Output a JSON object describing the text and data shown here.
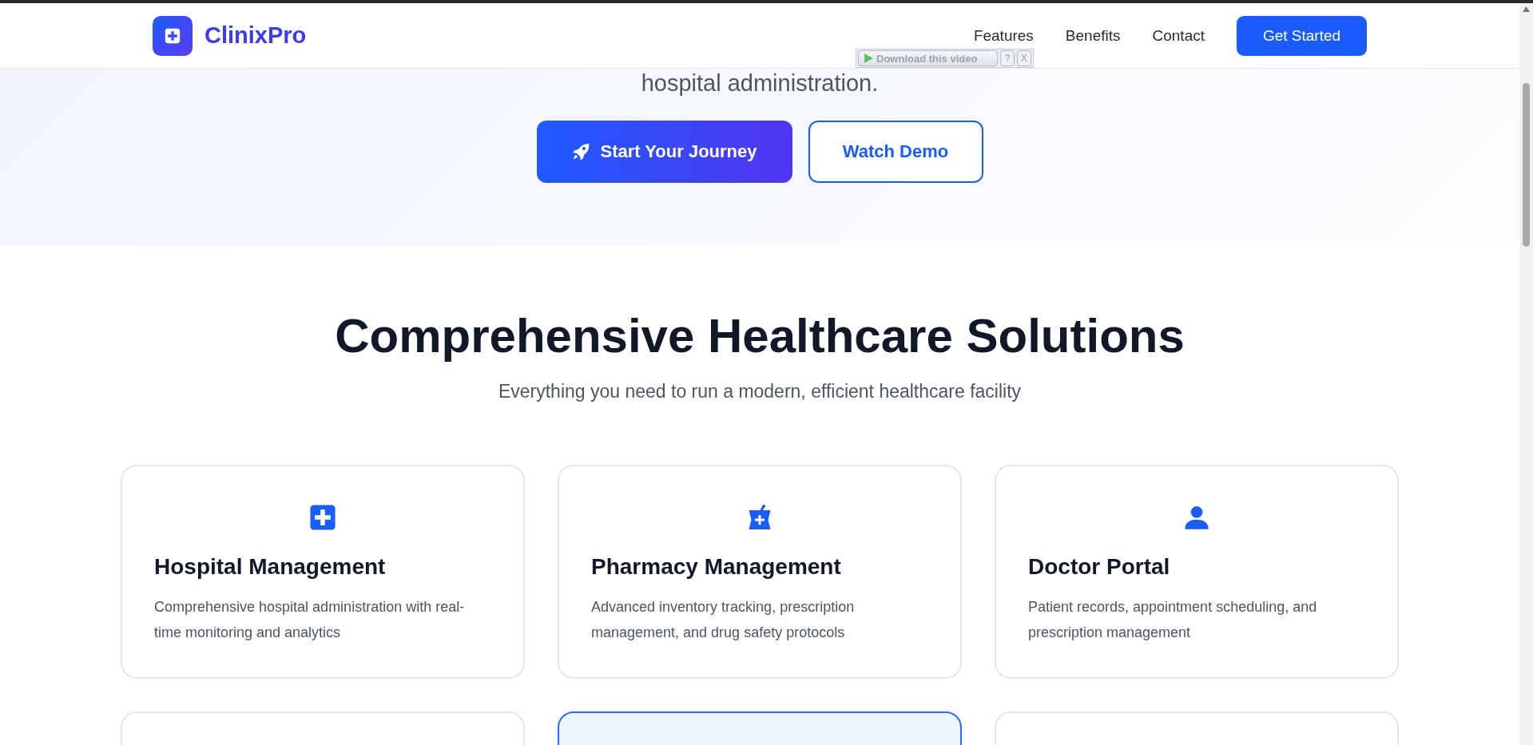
{
  "header": {
    "brand": "ClinixPro",
    "nav": [
      "Features",
      "Benefits",
      "Contact"
    ],
    "cta": "Get Started"
  },
  "video_overlay": {
    "label": "Download this video",
    "help": "?",
    "close": "X"
  },
  "hero": {
    "tagline_tail": "hospital administration.",
    "primary_button": "Start Your Journey",
    "secondary_button": "Watch Demo"
  },
  "features": {
    "title": "Comprehensive Healthcare Solutions",
    "subtitle": "Everything you need to run a modern, efficient healthcare facility",
    "cards": [
      {
        "kind": "hospital",
        "title": "Hospital Management",
        "description": "Comprehensive hospital administration with real-time monitoring and analytics"
      },
      {
        "kind": "pharmacy",
        "title": "Pharmacy Management",
        "description": "Advanced inventory tracking, prescription management, and drug safety protocols"
      },
      {
        "kind": "doctor",
        "title": "Doctor Portal",
        "description": "Patient records, appointment scheduling, and prescription management"
      }
    ],
    "next_row": [
      {
        "highlighted": false
      },
      {
        "highlighted": true
      },
      {
        "highlighted": false
      }
    ]
  }
}
